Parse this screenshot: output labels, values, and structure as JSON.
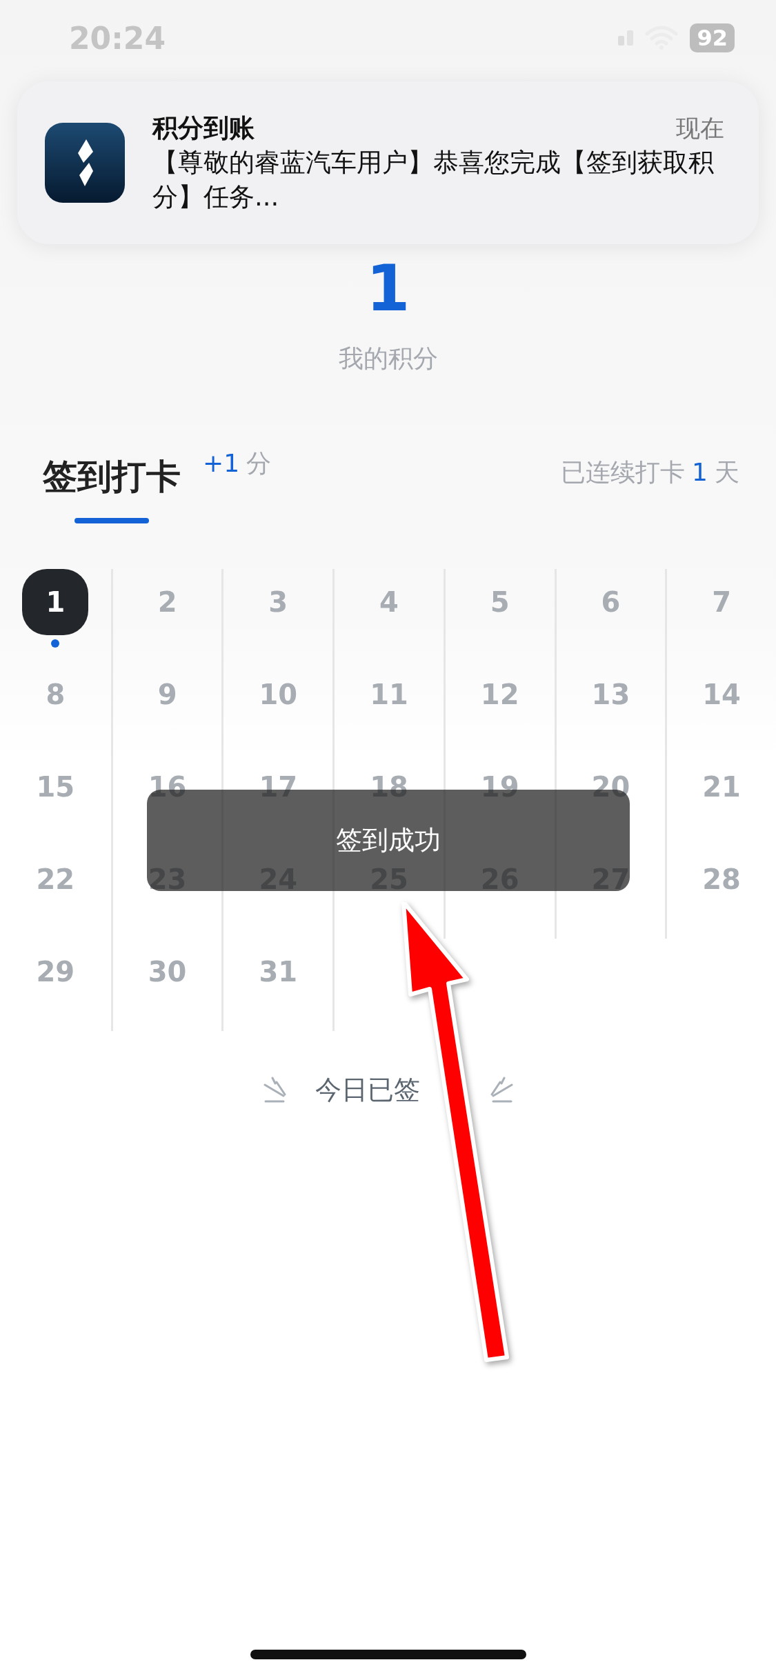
{
  "status_bar": {
    "time": "20:24",
    "battery": "92"
  },
  "notification": {
    "title": "积分到账",
    "time": "现在",
    "body": "【尊敬的睿蓝汽车用户】恭喜您完成【签到获取积分】任务..."
  },
  "points": {
    "value": "1",
    "label": "我的积分"
  },
  "checkin_header": {
    "tabs": [
      {
        "label": "签到打卡",
        "selected": true
      }
    ],
    "bonus_value": "+1",
    "bonus_unit": "分",
    "streak_prefix": "已连续打卡",
    "streak_days": "1",
    "streak_unit": "天"
  },
  "calendar": {
    "days": [
      {
        "label": "1",
        "selected": true
      },
      {
        "label": "2",
        "selected": false
      },
      {
        "label": "3",
        "selected": false
      },
      {
        "label": "4",
        "selected": false
      },
      {
        "label": "5",
        "selected": false
      },
      {
        "label": "6",
        "selected": false
      },
      {
        "label": "7",
        "selected": false
      },
      {
        "label": "8",
        "selected": false
      },
      {
        "label": "9",
        "selected": false
      },
      {
        "label": "10",
        "selected": false
      },
      {
        "label": "11",
        "selected": false
      },
      {
        "label": "12",
        "selected": false
      },
      {
        "label": "13",
        "selected": false
      },
      {
        "label": "14",
        "selected": false
      },
      {
        "label": "15",
        "selected": false
      },
      {
        "label": "16",
        "selected": false
      },
      {
        "label": "17",
        "selected": false
      },
      {
        "label": "18",
        "selected": false
      },
      {
        "label": "19",
        "selected": false
      },
      {
        "label": "20",
        "selected": false
      },
      {
        "label": "21",
        "selected": false
      },
      {
        "label": "22",
        "selected": false
      },
      {
        "label": "23",
        "selected": false
      },
      {
        "label": "24",
        "selected": false
      },
      {
        "label": "25",
        "selected": false
      },
      {
        "label": "26",
        "selected": false
      },
      {
        "label": "27",
        "selected": false
      },
      {
        "label": "28",
        "selected": false
      },
      {
        "label": "29",
        "selected": false
      },
      {
        "label": "30",
        "selected": false
      },
      {
        "label": "31",
        "selected": false
      }
    ]
  },
  "toast": {
    "text": "签到成功"
  },
  "today_status": {
    "text": "今日已签"
  }
}
